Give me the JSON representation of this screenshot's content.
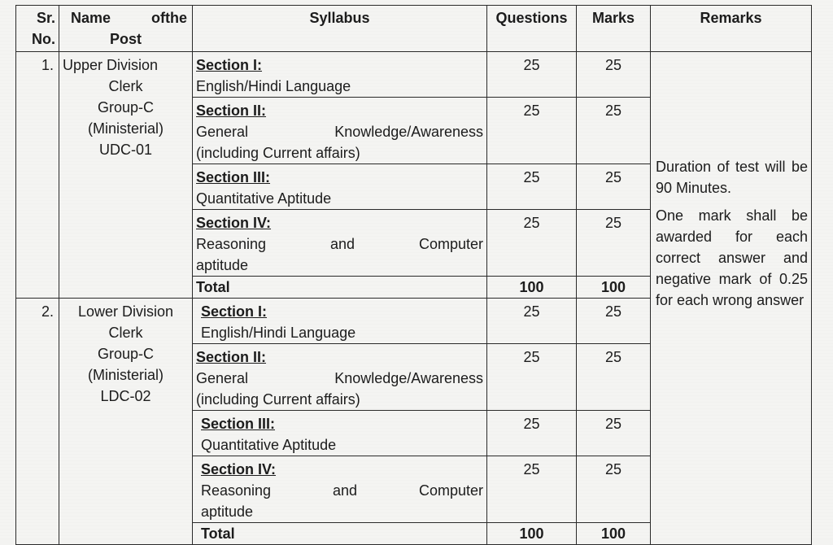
{
  "table": {
    "headers": {
      "sr_no": "Sr. No.",
      "sr_line1": "Sr.",
      "sr_line2": "No.",
      "name_line1_word1": "Name",
      "name_line1_word2": "ofthe",
      "name_line2": "Post",
      "syllabus": "Syllabus",
      "questions": "Questions",
      "marks": "Marks",
      "remarks": "Remarks"
    },
    "posts": [
      {
        "sr": "1.",
        "name_lines": [
          "Upper Division",
          "Clerk",
          "Group-C",
          "(Ministerial)",
          "UDC-01"
        ],
        "sections": [
          {
            "title": "Section I:",
            "text": "English/Hindi Language",
            "questions": "25",
            "marks": "25"
          },
          {
            "title": "Section II:",
            "text": "General Knowledge/Awareness",
            "text2": "(including Current affairs)",
            "questions": "25",
            "marks": "25"
          },
          {
            "title": "Section III:",
            "text": "Quantitative Aptitude",
            "questions": "25",
            "marks": "25"
          },
          {
            "title": "Section IV:",
            "text": "Reasoning and Computer",
            "text2": "aptitude",
            "questions": "25",
            "marks": "25"
          }
        ],
        "total_label": "Total",
        "total_questions": "100",
        "total_marks": "100"
      },
      {
        "sr": "2.",
        "name_lines": [
          "Lower Division",
          "Clerk",
          "Group-C",
          "(Ministerial)",
          "LDC-02"
        ],
        "sections": [
          {
            "title": "Section I:",
            "text": "English/Hindi Language",
            "questions": "25",
            "marks": "25"
          },
          {
            "title": "Section II:",
            "text": "General Knowledge/Awareness",
            "text2": "(including Current affairs)",
            "questions": "25",
            "marks": "25"
          },
          {
            "title": "Section III:",
            "text": "Quantitative Aptitude",
            "questions": "25",
            "marks": "25"
          },
          {
            "title": "Section IV:",
            "text": "Reasoning and Computer",
            "text2": "aptitude",
            "questions": "25",
            "marks": "25"
          }
        ],
        "total_label": "Total",
        "total_questions": "100",
        "total_marks": "100"
      }
    ],
    "remarks": {
      "duration": "Duration of test will be 90 Minutes.",
      "marking": "One mark shall be awarded for each correct answer and negative mark of 0.25 for each wrong answer"
    }
  }
}
